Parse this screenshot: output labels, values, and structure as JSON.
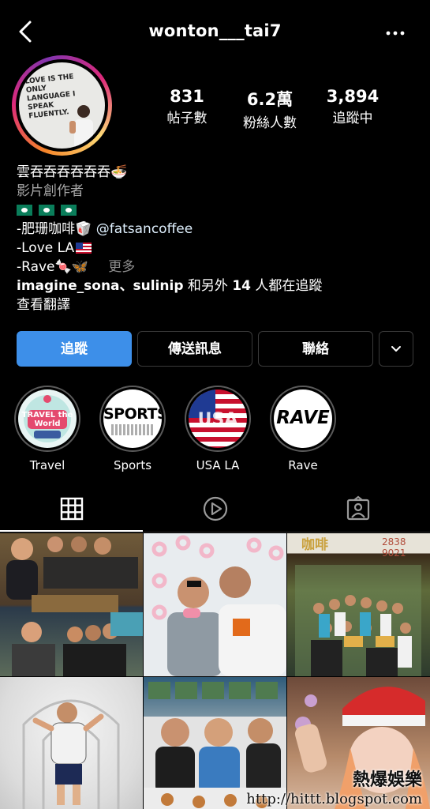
{
  "header": {
    "username": "wonton___tai7",
    "back_icon": "chevron-left-icon",
    "more_icon": "ellipsis-icon"
  },
  "avatar": {
    "sign_text": "LOVE IS THE ONLY LANGUAGE I SPEAK FLUENTLY."
  },
  "stats": {
    "posts": {
      "value": "831",
      "label": "帖子數"
    },
    "followers": {
      "value": "6.2萬",
      "label": "粉絲人數"
    },
    "following": {
      "value": "3,894",
      "label": "追蹤中"
    }
  },
  "bio": {
    "name": "雲吞吞吞吞吞吞🍜",
    "category": "影片創作者",
    "line_coffee": "-肥珊咖啡🥡",
    "coffee_mention": "@fatsancoffee",
    "line_love": "-Love LA",
    "line_rave": "-Rave🍬🦋",
    "more": "更多",
    "followed_by_users": "imagine_sona、sulinip",
    "followed_by_mid": " 和另外 ",
    "followed_by_count": "14",
    "followed_by_tail": " 人都在追蹤",
    "translate": "查看翻譯"
  },
  "buttons": {
    "follow": "追蹤",
    "message": "傳送訊息",
    "contact": "聯絡",
    "suggest_icon": "chevron-down-icon"
  },
  "highlights": [
    {
      "label": "Travel",
      "cover_text": "TRAVEL the World"
    },
    {
      "label": "Sports",
      "cover_text": "SPORTS"
    },
    {
      "label": "USA LA",
      "cover_text": "USA"
    },
    {
      "label": "Rave",
      "cover_text": "RAVE"
    }
  ],
  "tabs": {
    "grid_icon": "grid-icon",
    "reels_icon": "play-circle-icon",
    "tagged_icon": "tagged-person-icon"
  },
  "grid_posts": {
    "cafe_sign": "咖啡",
    "cafe_phone": "2838 9021"
  },
  "watermark": {
    "line1": "熱爆娛樂",
    "line2": "http://hittt.blogspot.com"
  },
  "colors": {
    "primary_button": "#3d8fe9",
    "background": "#000000"
  }
}
